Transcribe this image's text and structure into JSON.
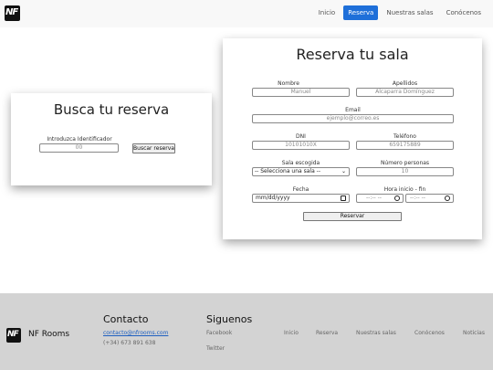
{
  "nav": {
    "logo": "NF",
    "links": [
      {
        "label": "Inicio",
        "active": false
      },
      {
        "label": "Reserva",
        "active": true
      },
      {
        "label": "Nuestras salas",
        "active": false
      },
      {
        "label": "Conócenos",
        "active": false
      }
    ]
  },
  "search_card": {
    "title": "Busca tu reserva",
    "id_label": "Introduzca Identificador",
    "id_placeholder": "00",
    "button": "Buscar reserva"
  },
  "reserve_card": {
    "title": "Reserva tu sala",
    "nombre_label": "Nombre",
    "nombre_placeholder": "Manuel",
    "apellidos_label": "Apellidos",
    "apellidos_placeholder": "Alcaparra Domínguez",
    "email_label": "Email",
    "email_placeholder": "ejemplo@correo.es",
    "dni_label": "DNI",
    "dni_placeholder": "10101010X",
    "telefono_label": "Teléfono",
    "telefono_placeholder": "659175889",
    "sala_label": "Sala escogida",
    "sala_selected": "-- Selecciona una sala --",
    "personas_label": "Número personas",
    "personas_placeholder": "10",
    "fecha_label": "Fecha",
    "fecha_value": "mm/dd/yyyy",
    "hora_label": "Hora inicio - fin",
    "hora_inicio": "--:-- --",
    "hora_fin": "--:-- --",
    "button": "Reservar"
  },
  "footer": {
    "logo": "NF",
    "brand": "NF Rooms",
    "contact_title": "Contacto",
    "contact_email": "contacto@nfrooms.com",
    "contact_phone": "(+34) 673 891 638",
    "follow_title": "Siguenos",
    "social": [
      "Facebook",
      "Twitter"
    ],
    "links": [
      "Inicio",
      "Reserva",
      "Nuestras salas",
      "Conócenos",
      "Noticias"
    ]
  }
}
